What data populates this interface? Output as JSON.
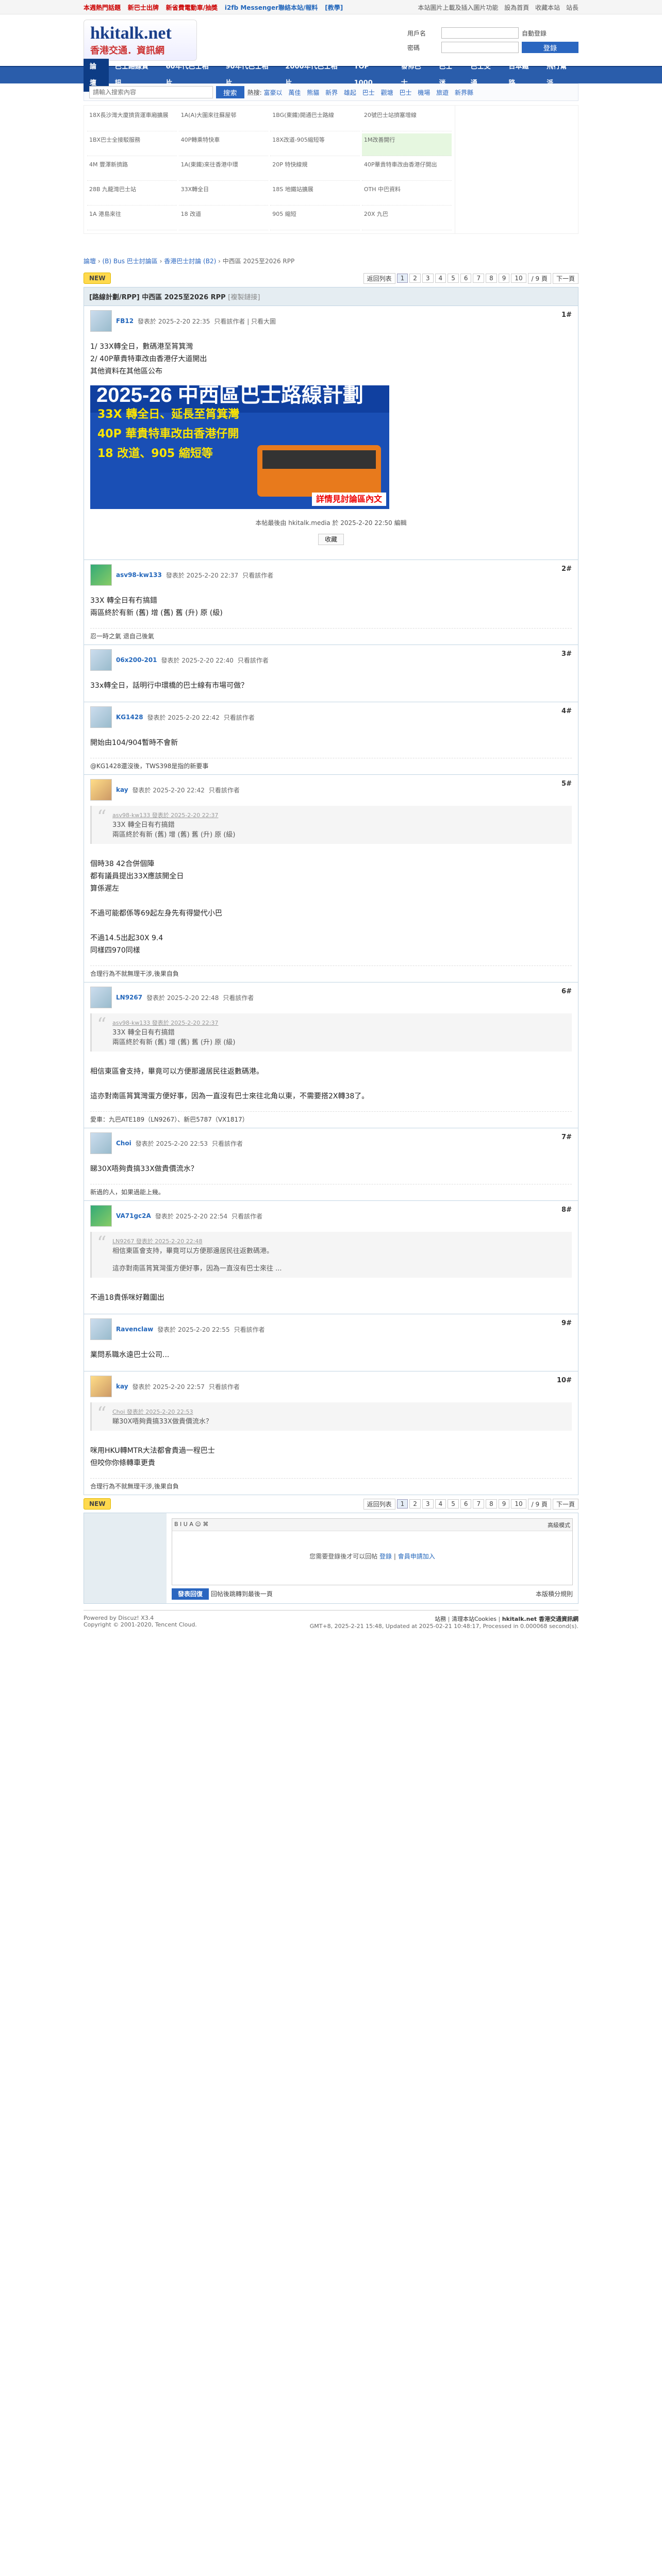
{
  "topbar": {
    "hot_links": [
      "本週熱門話題",
      "新巴士出牌",
      "新省費電動車/抽獎",
      "i2fb Messenger聯絡本站/報料",
      "[教學]"
    ],
    "right_links": [
      "本站圖片上載及插入圖片功能",
      "設為首頁",
      "收藏本站",
      "站長"
    ]
  },
  "logo": {
    "title": "hkitalk.net",
    "subtitle": "香港交通．資訊網"
  },
  "login": {
    "user_label": "用戶名",
    "pass_label": "密碼",
    "auto_login": "自動登錄",
    "forgot": "找回密碼",
    "login_btn": "登錄",
    "register": "立即註冊"
  },
  "nav": [
    "論壇",
    "巴士路線資訊",
    "60年代巴士相片",
    "90年代巴士相片",
    "2000年代巴士相片",
    "TOP 1000",
    "發佈巴士",
    "巴士迷",
    "巴士交通",
    "日本鐵路",
    "飛行幫派"
  ],
  "search": {
    "placeholder": "請輸入搜索內容",
    "btn": "搜索",
    "hot_label": "熱搜:",
    "hot": [
      "富豪以",
      "萬佳",
      "熊貓",
      "新界",
      "雄起",
      "巴士",
      "觀塘",
      "巴士",
      "機場",
      "旅遊",
      "新界縣"
    ]
  },
  "ad_tiles": [
    "18X長沙灣大廈擠貨運車廂擴展",
    "1A(A)大圍來往蘇屋邨",
    "1BG(東鐵)開通巴士路線",
    "20號巴士站擠塞增線",
    "1BX巴士全接駁服務",
    "40P轉乘特快車",
    "18X改道-905縮短等",
    "1M改善開行",
    "4M 豐澤新擠路",
    "1A(東鐵)來往香港中環",
    "20P 特快線規",
    "40P華貴特車改由香港仔開出",
    "28B 九龍灣巴士站",
    "33X轉全日",
    "18S 地鐵站擴展",
    "OTH 中巴資料",
    "1A 港島來往",
    "18 改道",
    "905 縮短",
    "20X 九巴",
    "42 新界西",
    "43M 大埔",
    "9 香港仔",
    "80M 觀塘"
  ],
  "breadcrumb": {
    "items": [
      "論壇",
      "(B) Bus 巴士討論區",
      "香港巴士討論 (B2)",
      "中西區 2025至2026 RPP"
    ]
  },
  "pager": {
    "new_label": "NEW",
    "back": "返回列表",
    "pages": [
      "1",
      "2",
      "3",
      "4",
      "5",
      "6",
      "7",
      "8",
      "9",
      "10"
    ],
    "total": "/ 9 頁",
    "next": "下一頁"
  },
  "thread": {
    "title": "[路線計劃/RPP] 中西區 2025至2026 RPP",
    "tag": "[複製鏈接]"
  },
  "posts": [
    {
      "user": "FB12",
      "time": "發表於 2025-2-20 22:35",
      "extra": "只看該作者 | 只看大圖",
      "floor": "1#",
      "body": [
        "1/ 33X轉全日，數碼港至筲箕灣",
        "2/ 40P華貴特車改由香港仔大道開出",
        "其他資料在其他區公布"
      ],
      "banner_title": "2025-26 中西區巴士路線計劃",
      "banner_lines": [
        "33X 轉全日、延長至筲箕灣",
        "40P 華貴特車改由香港仔開",
        "18 改道、905 縮短等"
      ],
      "banner_badge": "詳情見討論區內文",
      "note": "本帖最後由 hkitalk.media 於 2025-2-20 22:50 編輯",
      "fav": "收藏"
    },
    {
      "user": "asv98-kw133",
      "time": "發表於 2025-2-20 22:37",
      "extra": "只看該作者",
      "floor": "2#",
      "body": [
        "33X 轉全日有冇搞錯",
        "兩區終於有新 (舊) 增 (舊) 舊 (升) 原 (級)"
      ],
      "sig": "忍一時之氣 退自己後氣"
    },
    {
      "user": "06x200-201",
      "time": "發表於 2025-2-20 22:40",
      "extra": "只看該作者",
      "floor": "3#",
      "body": [
        "33x轉全日，話明行中環橋的巴士線有市場可做？"
      ]
    },
    {
      "user": "KG1428",
      "time": "發表於 2025-2-20 22:42",
      "extra": "只看該作者",
      "floor": "4#",
      "body": [
        "開始由104/904暫時不會新"
      ],
      "sig": "@KG1428還沒後，TWS398是指的新要事"
    },
    {
      "user": "kay",
      "time": "發表於 2025-2-20 22:42",
      "extra": "只看該作者",
      "floor": "5#",
      "quote_head": "asv98-kw133 發表於 2025-2-20 22:37",
      "quote": [
        "33X 轉全日有冇搞錯",
        "兩區終於有新 (舊) 增 (舊) 舊 (升) 原 (級)"
      ],
      "body": [
        "個時38 42合併個陣",
        "都有議員提出33X應該開全日",
        "算係遲左",
        "",
        "不過可能都係等69起左身先有得變代小巴",
        "",
        "不過14.5出起30X 9.4",
        "同樣四970同樣"
      ],
      "sig": "合理行為不就無理干涉,後果自負"
    },
    {
      "user": "LN9267",
      "time": "發表於 2025-2-20 22:48",
      "extra": "只看該作者",
      "floor": "6#",
      "quote_head": "asv98-kw133 發表於 2025-2-20 22:37",
      "quote": [
        "33X 轉全日有冇搞錯",
        "兩區終於有新 (舊) 增 (舊) 舊 (升) 原 (級)"
      ],
      "body": [
        "相信東區會支持，畢竟可以方便那邊居民往返數碼港。",
        "",
        "這亦對南區筲箕灣蛋方便好事，因為一直沒有巴士來往北角以東，不需要搭2X轉38了。"
      ],
      "sig": "愛車：九巴ATE189（LN9267）、新巴5787（VX1817）"
    },
    {
      "user": "Choi",
      "time": "發表於 2025-2-20 22:53",
      "extra": "只看該作者",
      "floor": "7#",
      "body": [
        "睇30X唔夠貴搞33X做貴價流水？"
      ],
      "sig": "新過的人，如果過能上幾。"
    },
    {
      "user": "VA71gc2A",
      "time": "發表於 2025-2-20 22:54",
      "extra": "只看該作者",
      "floor": "8#",
      "quote_head": "LN9267 發表於 2025-2-20 22:48",
      "quote": [
        "相信東區會支持，畢竟可以方便那邊居民往返數碼港。",
        "",
        "這亦對南區筲箕灣蛋方便好事，因為一直沒有巴士來往 ..."
      ],
      "body": [
        "不過18貴係咪好難圍出"
      ]
    },
    {
      "user": "Ravenclaw",
      "time": "發表於 2025-2-20 22:55",
      "extra": "只看該作者",
      "floor": "9#",
      "body": [
        "業問系職水遠巴士公司..."
      ]
    },
    {
      "user": "kay",
      "time": "發表於 2025-2-20 22:57",
      "extra": "只看該作者",
      "floor": "10#",
      "quote_head": "Choi 發表於 2025-2-20 22:53",
      "quote": [
        "睇30X唔夠貴搞33X做貴價流水？"
      ],
      "body": [
        "咪用HKU轉MTR大法都會貴過一程巴士",
        "但咬你你條轉車更貴"
      ],
      "sig": "合理行為不就無理干涉,後果自負"
    }
  ],
  "reply": {
    "mode": "高級模式",
    "msg_pre": "您需要登錄後才可以回帖",
    "login": "登錄",
    "sep": "|",
    "register": "會員申請加入",
    "btn": "發表回復",
    "check": "回帖後跳轉到最後一頁",
    "rules": "本版積分規則"
  },
  "footer": {
    "left": "Powered by Discuz! X3.4",
    "copy": "Copyright © 2001-2020, Tencent Cloud.",
    "right_links": [
      "站務",
      "清理本站Cookies",
      "hkitalk.net 香港交通資訊網"
    ],
    "time": "GMT+8, 2025-2-21 15:48, Updated at 2025-02-21 10:48:17, Processed in 0.000068 second(s)."
  }
}
